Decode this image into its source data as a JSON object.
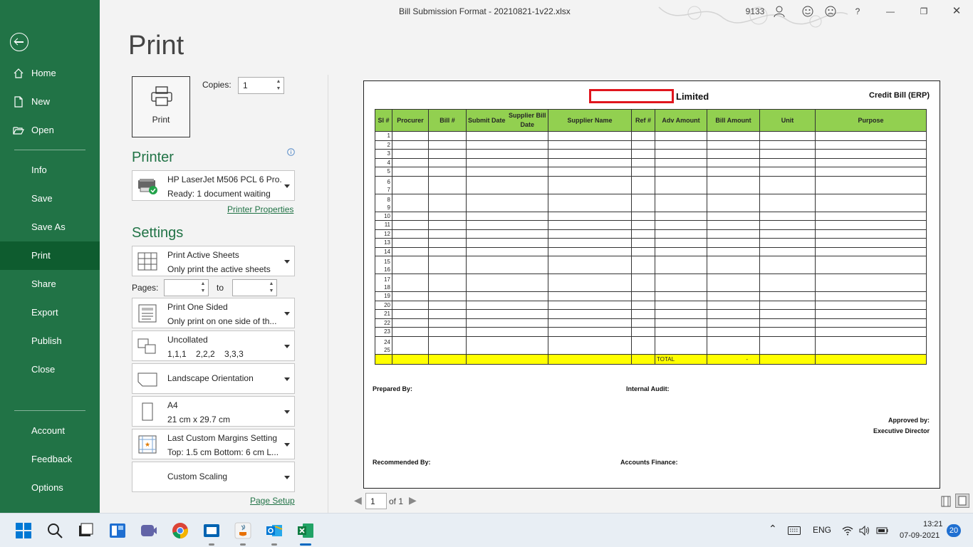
{
  "window": {
    "title": "Bill Submission Format - 20210821-1v22.xlsx",
    "user_count": "9133",
    "help": "?"
  },
  "sidebar": {
    "items": [
      {
        "label": "Home",
        "icon": "home-icon"
      },
      {
        "label": "New",
        "icon": "new-document-icon"
      },
      {
        "label": "Open",
        "icon": "folder-open-icon"
      },
      {
        "label": "Info"
      },
      {
        "label": "Save"
      },
      {
        "label": "Save As"
      },
      {
        "label": "Print",
        "active": true
      },
      {
        "label": "Share"
      },
      {
        "label": "Export"
      },
      {
        "label": "Publish"
      },
      {
        "label": "Close"
      }
    ],
    "bottom_items": [
      {
        "label": "Account"
      },
      {
        "label": "Feedback"
      },
      {
        "label": "Options"
      }
    ]
  },
  "print": {
    "heading": "Print",
    "button_label": "Print",
    "copies_label": "Copies:",
    "copies_value": "1",
    "printer_heading": "Printer",
    "printer_name": "HP LaserJet M506 PCL 6 Pro...",
    "printer_status": "Ready: 1 document waiting",
    "printer_properties": "Printer Properties",
    "settings_heading": "Settings",
    "what": {
      "title": "Print Active Sheets",
      "sub": "Only print the active sheets"
    },
    "pages_label": "Pages:",
    "pages_from": "",
    "pages_to_label": "to",
    "pages_to": "",
    "sides": {
      "title": "Print One Sided",
      "sub": "Only print on one side of th..."
    },
    "collate": {
      "title": "Uncollated",
      "sub": "1,1,1    2,2,2    3,3,3"
    },
    "orientation": {
      "title": "Landscape Orientation"
    },
    "paper": {
      "title": "A4",
      "sub": "21 cm x 29.7 cm"
    },
    "margins": {
      "title": "Last Custom Margins Setting",
      "sub": "Top: 1.5 cm Bottom: 6 cm L..."
    },
    "scaling": {
      "title": "Custom Scaling"
    },
    "page_setup": "Page Setup"
  },
  "preview": {
    "company_suffix": "Limited",
    "doc_type": "Credit Bill (ERP)",
    "columns": [
      "Sl #",
      "Procurer",
      "Bill #",
      "Submit Date",
      "Supplier Bill Date",
      "Supplier Name",
      "Ref #",
      "Adv Amount",
      "Bill Amount",
      "Unit",
      "Purpose"
    ],
    "row_numbers": [
      "1",
      "2",
      "3",
      "4",
      "5",
      "6",
      "7",
      "8",
      "9",
      "10",
      "11",
      "12",
      "13",
      "14",
      "15",
      "16",
      "17",
      "18",
      "19",
      "20",
      "21",
      "22",
      "23",
      "24",
      "25"
    ],
    "total_label": "TOTAL",
    "total_value": "-",
    "prepared_by": "Prepared By:",
    "internal_audit": "Internal Audit:",
    "approved_by": "Approved by:",
    "executive_director": "Executive Director",
    "recommended_by": "Recommended By:",
    "accounts_finance": "Accounts Finance:"
  },
  "page_nav": {
    "current": "1",
    "of": "of 1"
  },
  "taskbar": {
    "lang": "ENG",
    "time": "13:21",
    "date": "07-09-2021",
    "badge": "20"
  },
  "colors": {
    "excel_green": "#217346",
    "header_green": "#92d050",
    "total_yellow": "#ffff00",
    "redact_red": "#e0161e"
  }
}
